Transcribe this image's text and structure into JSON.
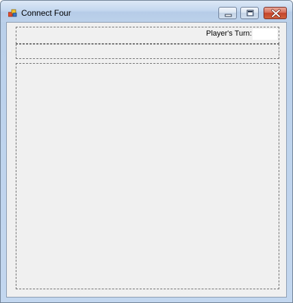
{
  "window": {
    "title": "Connect Four",
    "icon": "app-form-icon",
    "controls": {
      "minimize_icon": "minimize-icon",
      "maximize_icon": "maximize-icon",
      "close_icon": "close-icon"
    }
  },
  "status": {
    "turn_label": "Player's Turn:",
    "turn_value": ""
  },
  "colors": {
    "client_background": "#f0f0f0",
    "panel_border": "#6e6e6e",
    "close_button": "#c4432a"
  }
}
